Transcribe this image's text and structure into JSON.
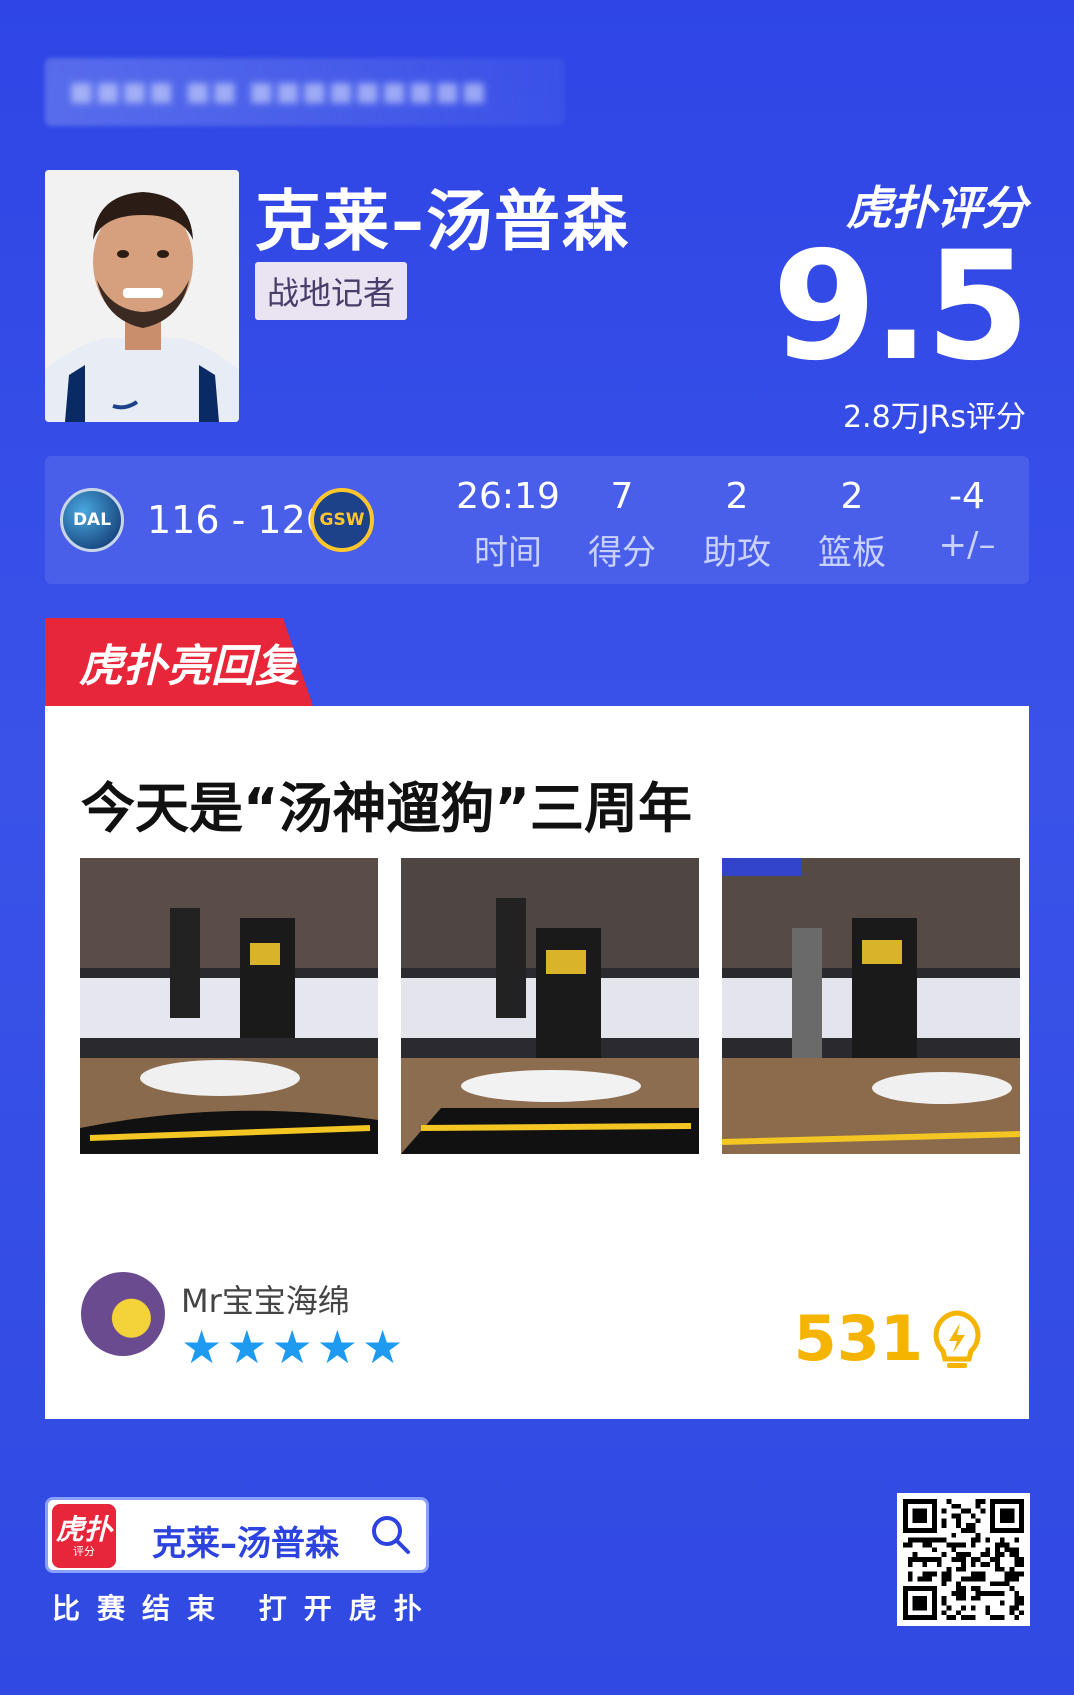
{
  "header": {
    "blurred_text": "■■■■ ■■ ■■■■■■■■■"
  },
  "player": {
    "name": "克莱–汤普森",
    "badge": "战地记者"
  },
  "rating": {
    "brand": "虎扑评分",
    "score": "9.5",
    "count": "2.8万JRs评分"
  },
  "game": {
    "team_home_abbr": "DAL",
    "team_away_abbr": "GSW",
    "score": "116 - 126",
    "stats": [
      {
        "value": "26:19",
        "label": "时间"
      },
      {
        "value": "7",
        "label": "得分"
      },
      {
        "value": "2",
        "label": "助攻"
      },
      {
        "value": "2",
        "label": "篮板"
      },
      {
        "value": "-4",
        "label": "+/–"
      }
    ]
  },
  "highlight": {
    "tab_label": "虎扑亮回复",
    "title": "今天是“汤神遛狗”三周年",
    "user": "Mr宝宝海绵",
    "stars": "★★★★★",
    "star_rating": 5,
    "likes": "531"
  },
  "footer": {
    "app_icon_main": "虎扑",
    "app_icon_sub": "评分",
    "search_text": "克莱–汤普森",
    "tagline": "比赛结束 打开虎扑"
  },
  "colors": {
    "background": "#3049e2",
    "accent_red": "#e8263a",
    "star_blue": "#1e9bf0",
    "likes_gold": "#f5b400"
  }
}
